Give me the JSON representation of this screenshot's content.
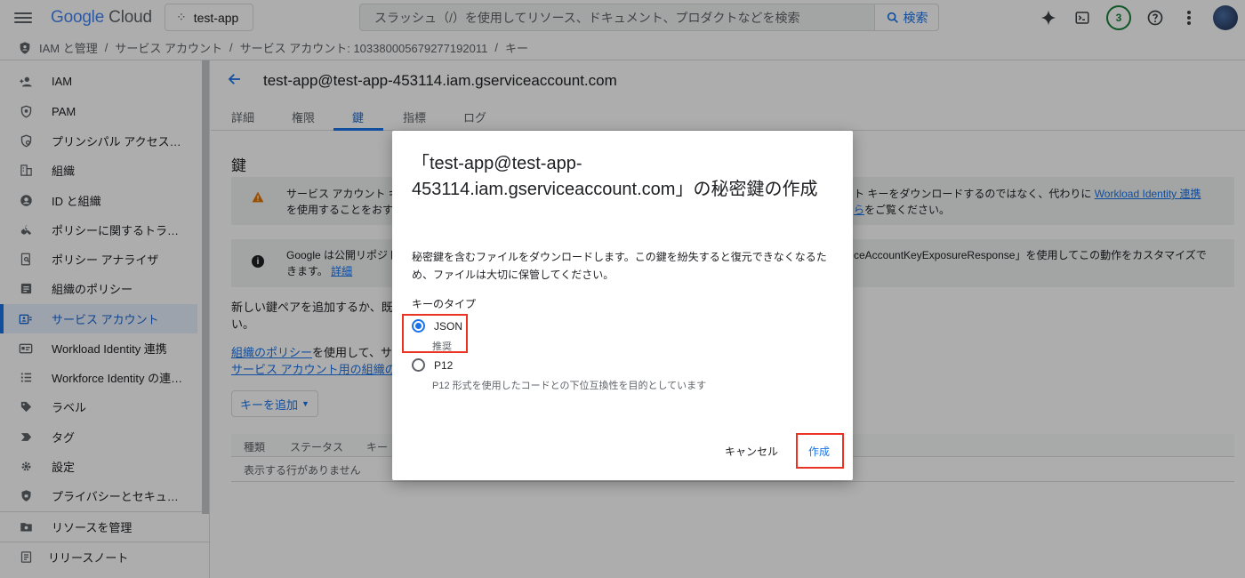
{
  "topbar": {
    "logo_google": "Google",
    "logo_cloud": "Cloud",
    "project": "test-app",
    "search_placeholder": "スラッシュ（/）を使用してリソース、ドキュメント、プロダクトなどを検索",
    "search_button": "検索",
    "notification_count": "3"
  },
  "breadcrumb": {
    "items": [
      "IAM と管理",
      "/",
      "サービス アカウント",
      "/",
      "サービス アカウント: 103380005679277192011",
      "/",
      "キー"
    ]
  },
  "sidebar": {
    "items": [
      {
        "label": "IAM",
        "icon": "person-add-icon"
      },
      {
        "label": "PAM",
        "icon": "shield-icon"
      },
      {
        "label": "プリンシパル アクセス…",
        "icon": "policy-icon"
      },
      {
        "label": "組織",
        "icon": "building-icon"
      },
      {
        "label": "ID と組織",
        "icon": "account-circle-icon"
      },
      {
        "label": "ポリシーに関するトラ…",
        "icon": "wrench-icon"
      },
      {
        "label": "ポリシー アナライザ",
        "icon": "document-search-icon"
      },
      {
        "label": "組織のポリシー",
        "icon": "list-box-icon"
      },
      {
        "label": "サービス アカウント",
        "icon": "service-account-icon"
      },
      {
        "label": "Workload Identity 連携",
        "icon": "id-card-icon"
      },
      {
        "label": "Workforce Identity の連…",
        "icon": "list-icon"
      },
      {
        "label": "ラベル",
        "icon": "tag-icon"
      },
      {
        "label": "タグ",
        "icon": "chevron-tag-icon"
      },
      {
        "label": "設定",
        "icon": "gear-icon"
      },
      {
        "label": "プライバシーとセキュ…",
        "icon": "shield-lock-icon"
      }
    ],
    "manage_resources": "リソースを管理",
    "release_notes": "リリースノート"
  },
  "main": {
    "title": "test-app@test-app-453114.iam.gserviceaccount.com",
    "tabs": [
      "詳細",
      "権限",
      "鍵",
      "指標",
      "ログ"
    ],
    "section_title": "鍵",
    "warning_line1_left": "サービス アカウント キ",
    "warning_line1_right": "ト キーをダウンロードするのではなく、代わりに",
    "warning_link": "Workload Identity 連携",
    "warning_line2_left": "を使用することをおす",
    "warning_link2": "ら",
    "warning_line2_right": "をご覧ください。",
    "info_line1_left": "Google は公開リポジト",
    "info_line1_right": "ceAccountKeyExposureResponse」を使用してこの動作をカスタマイズで",
    "info_line2_left": "きます。",
    "info_link": "詳細",
    "para1_line1": "新しい鍵ペアを追加するか、既存",
    "para1_line2": "い。",
    "para2_link": "組織のポリシー",
    "para2_text": "を使用して、サ",
    "para2_link2": "サービス アカウント用の組織のポ",
    "add_key": "キーを追加",
    "table_headers": [
      "種類",
      "ステータス",
      "キー"
    ],
    "table_empty": "表示する行がありません"
  },
  "dialog": {
    "title": "「test-app@test-app-453114.iam.gserviceaccount.com」の秘密鍵の作成",
    "description": "秘密鍵を含むファイルをダウンロードします。この鍵を紛失すると復元できなくなるため、ファイルは大切に保管してください。",
    "key_type_label": "キーのタイプ",
    "options": [
      {
        "label": "JSON",
        "sub": "推奨",
        "checked": true
      },
      {
        "label": "P12",
        "sub": "P12 形式を使用したコードとの下位互換性を目的としています",
        "checked": false
      }
    ],
    "cancel": "キャンセル",
    "create": "作成"
  }
}
